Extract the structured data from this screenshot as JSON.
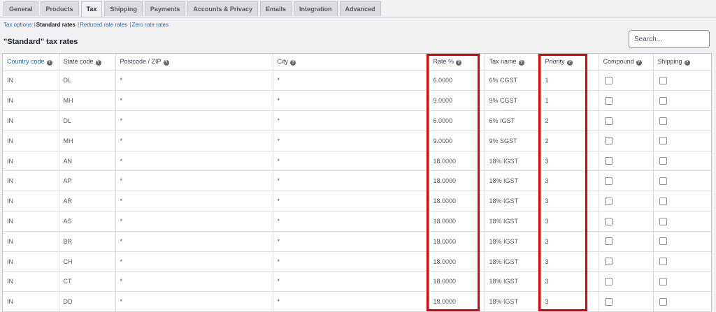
{
  "tabs": [
    {
      "label": "General",
      "active": false
    },
    {
      "label": "Products",
      "active": false
    },
    {
      "label": "Tax",
      "active": true
    },
    {
      "label": "Shipping",
      "active": false
    },
    {
      "label": "Payments",
      "active": false
    },
    {
      "label": "Accounts & Privacy",
      "active": false
    },
    {
      "label": "Emails",
      "active": false
    },
    {
      "label": "Integration",
      "active": false
    },
    {
      "label": "Advanced",
      "active": false
    }
  ],
  "subnav": {
    "tax_options": "Tax options",
    "standard_rates": "Standard rates",
    "reduced_rates": "Reduced rate rates",
    "zero_rates": "Zero rate rates",
    "separator": "|"
  },
  "page_title": "\"Standard\" tax rates",
  "search": {
    "placeholder": "Search...",
    "value": ""
  },
  "table": {
    "columns": [
      {
        "key": "country",
        "label": "Country code",
        "sortable": true
      },
      {
        "key": "state",
        "label": "State code",
        "sortable": false
      },
      {
        "key": "postcode",
        "label": "Postcode / ZIP",
        "sortable": false
      },
      {
        "key": "city",
        "label": "City",
        "sortable": false
      },
      {
        "key": "rate",
        "label": "Rate %",
        "sortable": false
      },
      {
        "key": "name",
        "label": "Tax name",
        "sortable": false
      },
      {
        "key": "priority",
        "label": "Priority",
        "sortable": false
      },
      {
        "key": "compound",
        "label": "Compound",
        "sortable": false
      },
      {
        "key": "shipping",
        "label": "Shipping",
        "sortable": false
      }
    ],
    "help_glyph": "?",
    "rows": [
      {
        "country": "IN",
        "state": "DL",
        "postcode": "*",
        "city": "*",
        "rate": "6.0000",
        "name": "6% CGST",
        "priority": "1",
        "compound": false,
        "shipping": false
      },
      {
        "country": "IN",
        "state": "MH",
        "postcode": "*",
        "city": "*",
        "rate": "9.0000",
        "name": "9% CGST",
        "priority": "1",
        "compound": false,
        "shipping": false
      },
      {
        "country": "IN",
        "state": "DL",
        "postcode": "*",
        "city": "*",
        "rate": "6.0000",
        "name": "6% IGST",
        "priority": "2",
        "compound": false,
        "shipping": false
      },
      {
        "country": "IN",
        "state": "MH",
        "postcode": "*",
        "city": "*",
        "rate": "9.0000",
        "name": "9% SGST",
        "priority": "2",
        "compound": false,
        "shipping": false
      },
      {
        "country": "IN",
        "state": "AN",
        "postcode": "*",
        "city": "*",
        "rate": "18.0000",
        "name": "18% IGST",
        "priority": "3",
        "compound": false,
        "shipping": false
      },
      {
        "country": "IN",
        "state": "AP",
        "postcode": "*",
        "city": "*",
        "rate": "18.0000",
        "name": "18% IGST",
        "priority": "3",
        "compound": false,
        "shipping": false
      },
      {
        "country": "IN",
        "state": "AR",
        "postcode": "*",
        "city": "*",
        "rate": "18.0000",
        "name": "18% IGST",
        "priority": "3",
        "compound": false,
        "shipping": false
      },
      {
        "country": "IN",
        "state": "AS",
        "postcode": "*",
        "city": "*",
        "rate": "18.0000",
        "name": "18% IGST",
        "priority": "3",
        "compound": false,
        "shipping": false
      },
      {
        "country": "IN",
        "state": "BR",
        "postcode": "*",
        "city": "*",
        "rate": "18.0000",
        "name": "18% IGST",
        "priority": "3",
        "compound": false,
        "shipping": false
      },
      {
        "country": "IN",
        "state": "CH",
        "postcode": "*",
        "city": "*",
        "rate": "18.0000",
        "name": "18% IGST",
        "priority": "3",
        "compound": false,
        "shipping": false
      },
      {
        "country": "IN",
        "state": "CT",
        "postcode": "*",
        "city": "*",
        "rate": "18.0000",
        "name": "18% IGST",
        "priority": "3",
        "compound": false,
        "shipping": false
      },
      {
        "country": "IN",
        "state": "DD",
        "postcode": "*",
        "city": "*",
        "rate": "18.0000",
        "name": "18% IGST",
        "priority": "3",
        "compound": false,
        "shipping": false
      }
    ]
  },
  "colors": {
    "highlight": "#e00000",
    "link": "#2271b1"
  }
}
